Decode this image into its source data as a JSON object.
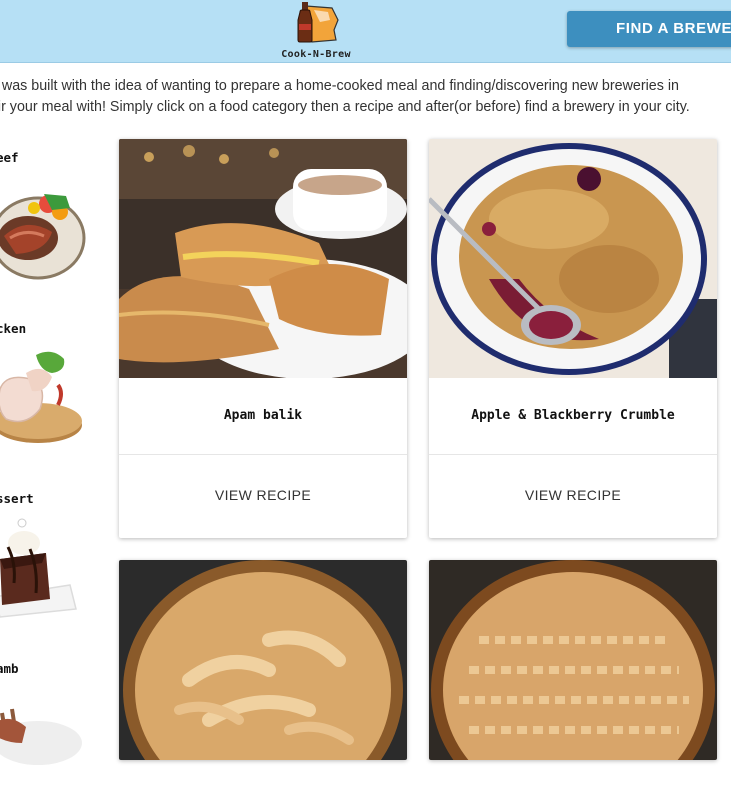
{
  "header": {
    "logo_text": "Cook-N-Brew",
    "find_brewery_label": "FIND A BREWERY"
  },
  "intro": {
    "line1": "on was built with the idea of wanting to prepare a home-cooked meal and finding/discovering new breweries in",
    "line2": "pair your meal with! Simply click on a food category then a recipe and after(or before) find a brewery in your city."
  },
  "sidebar": {
    "categories": [
      {
        "label": "eef"
      },
      {
        "label": "cken"
      },
      {
        "label": "ssert"
      },
      {
        "label": "amb"
      }
    ]
  },
  "cards": [
    {
      "title": "Apam balik",
      "action": "VIEW RECIPE"
    },
    {
      "title": "Apple & Blackberry Crumble",
      "action": "VIEW RECIPE"
    }
  ],
  "colors": {
    "header_bg": "#b6e0f5",
    "button_bg": "#3d8fbf"
  }
}
